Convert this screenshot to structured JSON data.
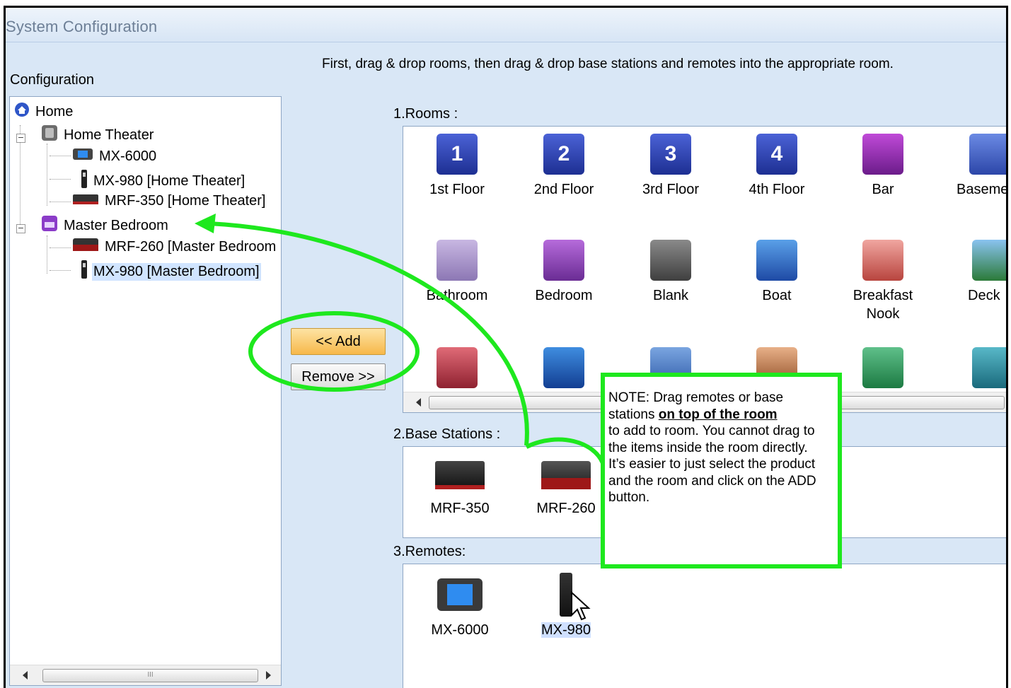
{
  "window": {
    "title": "System Configuration"
  },
  "instruction": "First, drag & drop rooms, then drag & drop base stations and remotes into the appropriate room.",
  "configuration_label": "Configuration",
  "tree": {
    "nodes": [
      {
        "label": "Home",
        "icon": "home-icon"
      },
      {
        "label": "Home Theater",
        "icon": "home-theater-room-icon"
      },
      {
        "label": "MX-6000",
        "icon": "mx-6000-device-icon"
      },
      {
        "label": "MX-980 [Home Theater]",
        "icon": "mx-980-device-icon"
      },
      {
        "label": "MRF-350 [Home Theater]",
        "icon": "mrf-350-device-icon"
      },
      {
        "label": "Master Bedroom",
        "icon": "bedroom-room-icon"
      },
      {
        "label": "MRF-260 [Master Bedroom",
        "icon": "mrf-260-device-icon"
      },
      {
        "label": "MX-980 [Master Bedroom]",
        "icon": "mx-980-device-icon"
      }
    ],
    "scroll_thumb_glyph": "III"
  },
  "buttons": {
    "add": "<< Add",
    "remove": "Remove >>"
  },
  "rooms": {
    "label": "1.Rooms :",
    "items": [
      {
        "label": "1st Floor",
        "icon_text": "1"
      },
      {
        "label": "2nd Floor",
        "icon_text": "2"
      },
      {
        "label": "3rd Floor",
        "icon_text": "3"
      },
      {
        "label": "4th Floor",
        "icon_text": "4"
      },
      {
        "label": "Bar",
        "icon_text": ""
      },
      {
        "label": "Baseme",
        "icon_text": ""
      },
      {
        "label": "Bathroom",
        "icon_text": ""
      },
      {
        "label": "Bedroom",
        "icon_text": ""
      },
      {
        "label": "Blank",
        "icon_text": ""
      },
      {
        "label": "Boat",
        "icon_text": ""
      },
      {
        "label": "Breakfast Nook",
        "icon_text": ""
      },
      {
        "label": "Deck",
        "icon_text": ""
      }
    ]
  },
  "base_stations": {
    "label": "2.Base Stations :",
    "items": [
      {
        "label": "MRF-350"
      },
      {
        "label": "MRF-260"
      }
    ]
  },
  "remotes": {
    "label": "3.Remotes:",
    "items": [
      {
        "label": "MX-6000"
      },
      {
        "label": "MX-980"
      }
    ]
  },
  "note": {
    "line1": "NOTE: Drag remotes or base",
    "line2_pre": "stations ",
    "line2_bold": "on top of the room",
    "rest1": "to add to room. You cannot drag to the items inside the room directly.",
    "rest2": "It’s easier to just select the product and the room and click on the ADD button."
  },
  "colors": {
    "annotation": "#1ee81e",
    "window_bg": "#d9e7f6",
    "selection": "#d0e4ff",
    "add_button": "#f7b84a"
  }
}
